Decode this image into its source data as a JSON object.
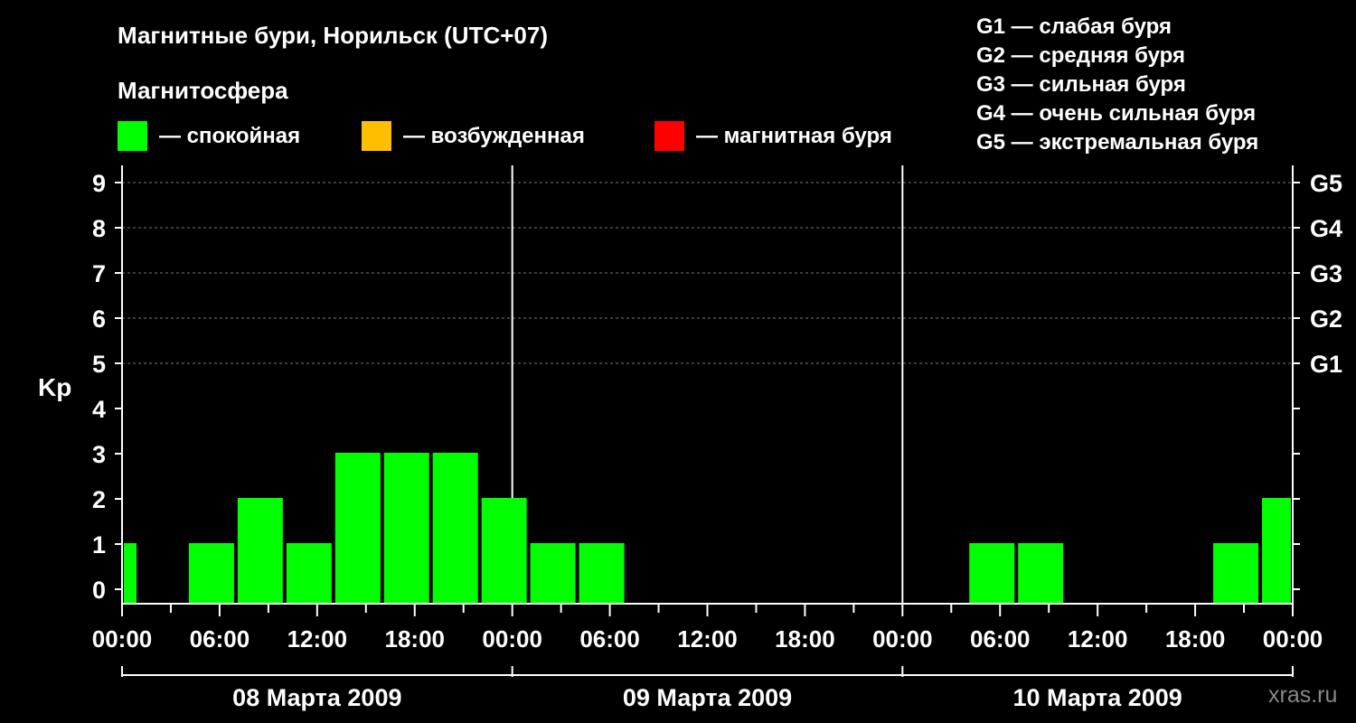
{
  "chart_data": {
    "type": "bar",
    "title": "Магнитные бури, Норильск (UTC+07)",
    "legend_title": "Магнитосфера",
    "legend": [
      {
        "label": "— спокойная",
        "color": "#00ff00"
      },
      {
        "label": "— возбужденная",
        "color": "#ffbf00"
      },
      {
        "label": "— магнитная буря",
        "color": "#ff0000"
      }
    ],
    "storm_scale": [
      "G1 — слабая буря",
      "G2 — средняя буря",
      "G3 — сильная буря",
      "G4 — очень сильная буря",
      "G5 — экстремальная буря"
    ],
    "ylabel": "Kp",
    "ylim": [
      0,
      9
    ],
    "y_ticks": [
      0,
      1,
      2,
      3,
      4,
      5,
      6,
      7,
      8,
      9
    ],
    "right_ticks": [
      {
        "value": 5,
        "label": "G1"
      },
      {
        "value": 6,
        "label": "G2"
      },
      {
        "value": 7,
        "label": "G3"
      },
      {
        "value": 8,
        "label": "G4"
      },
      {
        "value": 9,
        "label": "G5"
      }
    ],
    "x_tick_labels": [
      "00:00",
      "06:00",
      "12:00",
      "18:00",
      "00:00",
      "06:00",
      "12:00",
      "18:00",
      "00:00",
      "06:00",
      "12:00",
      "18:00",
      "00:00"
    ],
    "days": [
      "08 Марта 2009",
      "09 Марта 2009",
      "10 Марта 2009"
    ],
    "bars": [
      {
        "start_hour": 0,
        "end_hour": 1,
        "kp": 1
      },
      {
        "start_hour": 4,
        "end_hour": 7,
        "kp": 1
      },
      {
        "start_hour": 7,
        "end_hour": 10,
        "kp": 2
      },
      {
        "start_hour": 10,
        "end_hour": 13,
        "kp": 1
      },
      {
        "start_hour": 13,
        "end_hour": 16,
        "kp": 3
      },
      {
        "start_hour": 16,
        "end_hour": 19,
        "kp": 3
      },
      {
        "start_hour": 19,
        "end_hour": 22,
        "kp": 3
      },
      {
        "start_hour": 22,
        "end_hour": 25,
        "kp": 2
      },
      {
        "start_hour": 25,
        "end_hour": 28,
        "kp": 1
      },
      {
        "start_hour": 28,
        "end_hour": 31,
        "kp": 1
      },
      {
        "start_hour": 52,
        "end_hour": 55,
        "kp": 1
      },
      {
        "start_hour": 55,
        "end_hour": 58,
        "kp": 1
      },
      {
        "start_hour": 67,
        "end_hour": 70,
        "kp": 1
      },
      {
        "start_hour": 70,
        "end_hour": 72,
        "kp": 2
      }
    ],
    "grid": true,
    "watermark": "xras.ru"
  }
}
